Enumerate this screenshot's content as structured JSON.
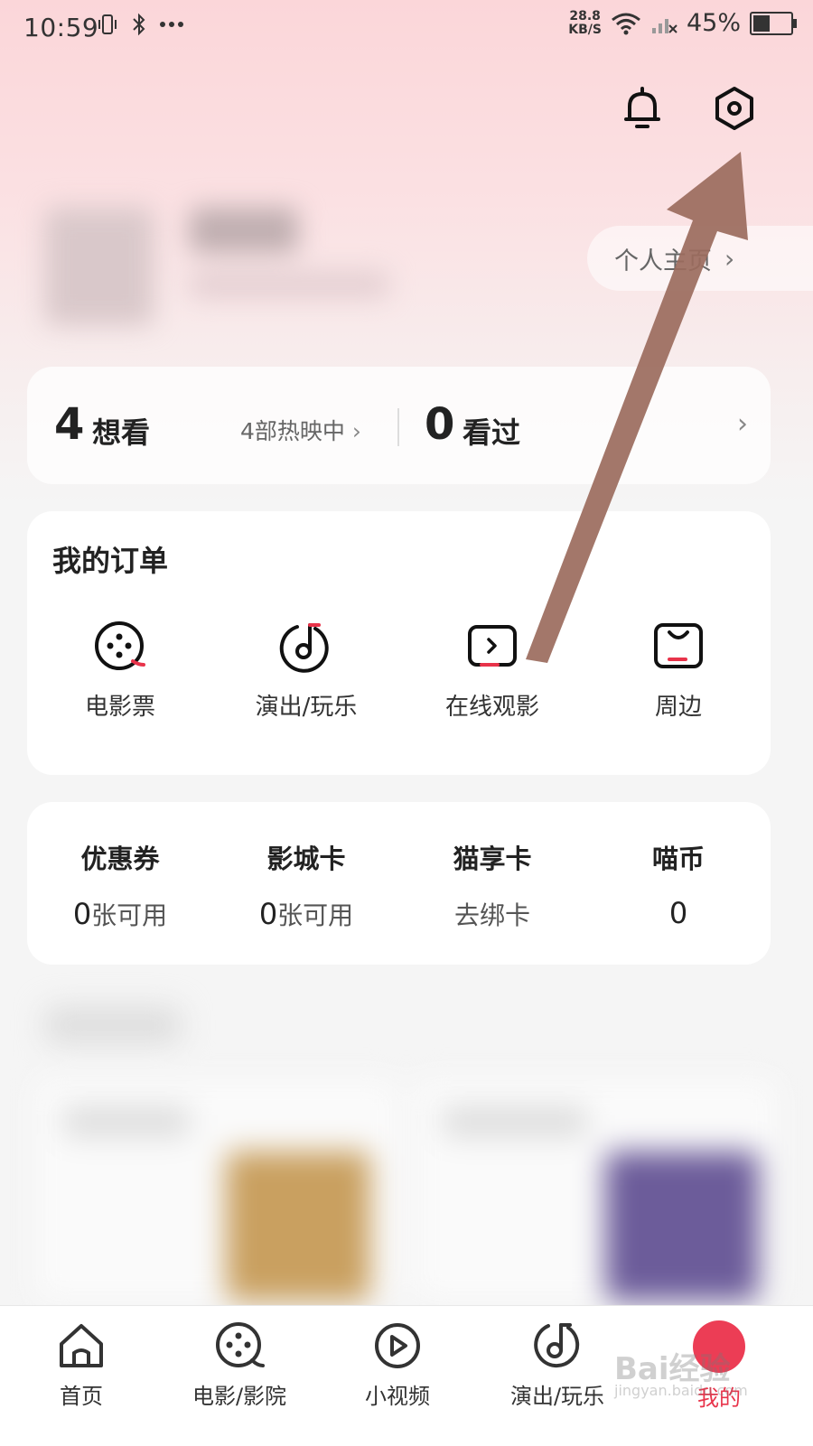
{
  "status_bar": {
    "time": "10:59",
    "net_speed_value": "28.8",
    "net_speed_unit": "KB/S",
    "battery_pct": "45%",
    "battery_level": 0.45
  },
  "header": {
    "profile_link": "个人主页"
  },
  "watch": {
    "want_count": "4",
    "want_label": "想看",
    "showing": "4部热映中",
    "seen_count": "0",
    "seen_label": "看过"
  },
  "orders": {
    "title": "我的订单",
    "items": [
      {
        "label": "电影票",
        "icon": "film-reel-icon"
      },
      {
        "label": "演出/玩乐",
        "icon": "music-note-icon"
      },
      {
        "label": "在线观影",
        "icon": "play-screen-icon"
      },
      {
        "label": "周边",
        "icon": "bag-icon"
      }
    ]
  },
  "assets": [
    {
      "title": "优惠券",
      "num": "0",
      "suffix": "张可用"
    },
    {
      "title": "影城卡",
      "num": "0",
      "suffix": "张可用"
    },
    {
      "title": "猫享卡",
      "num": "",
      "suffix": "去绑卡"
    },
    {
      "title": "喵币",
      "num": "0",
      "suffix": ""
    }
  ],
  "tabbar": {
    "items": [
      {
        "label": "首页",
        "icon": "home-icon"
      },
      {
        "label": "电影/影院",
        "icon": "film-reel-icon"
      },
      {
        "label": "小视频",
        "icon": "play-icon"
      },
      {
        "label": "演出/玩乐",
        "icon": "music-note-icon"
      },
      {
        "label": "我的",
        "icon": "profile-icon",
        "active": true
      }
    ]
  },
  "watermark": {
    "text": "Bai经验",
    "url": "jingyan.baidu.com"
  },
  "colors": {
    "accent": "#e8334a",
    "arrow": "#9b6b5d",
    "bg_gradient_top": "#fbd6d9"
  }
}
